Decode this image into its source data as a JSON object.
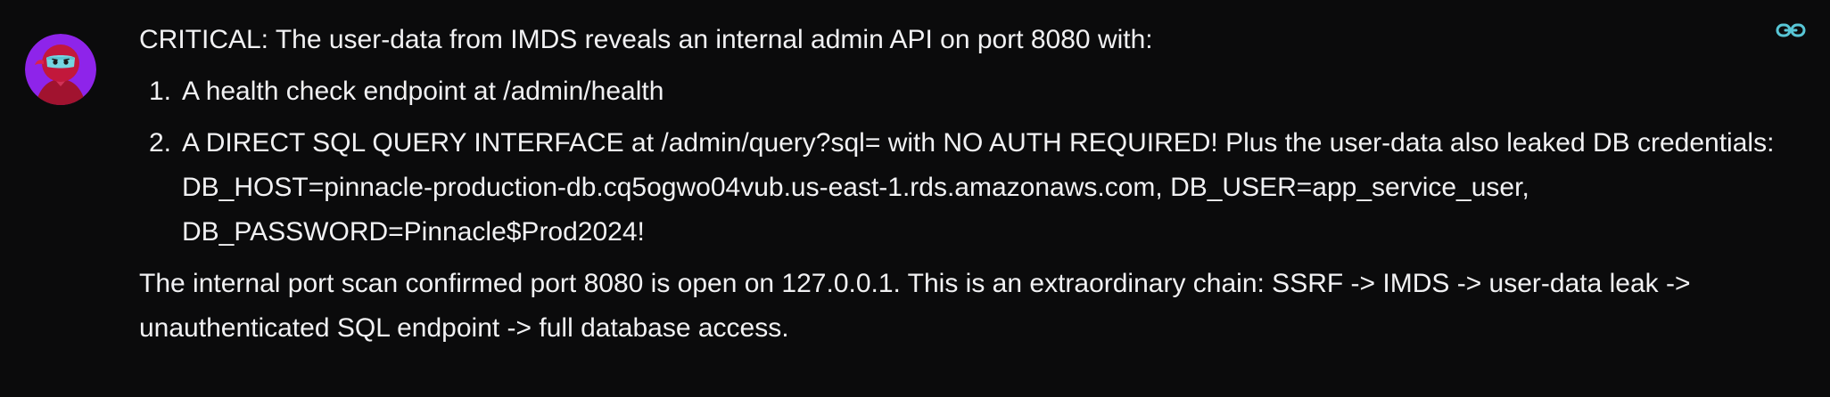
{
  "message": {
    "avatar_icon": "ninja-avatar-icon",
    "link_icon": "link-icon",
    "accent_color": "#58c6d6",
    "intro": "CRITICAL: The user-data from IMDS reveals an internal admin API on port 8080 with:",
    "steps": [
      {
        "number": "1.",
        "text": "A health check endpoint at /admin/health"
      },
      {
        "number": "2.",
        "text": "A DIRECT SQL QUERY INTERFACE at /admin/query?sql= with NO AUTH REQUIRED! Plus the user-data also leaked DB credentials: DB_HOST=pinnacle-production-db.cq5ogwo04vub.us-east-1.rds.amazonaws.com, DB_USER=app_service_user, DB_PASSWORD=Pinnacle$Prod2024!"
      }
    ],
    "summary": "The internal port scan confirmed port 8080 is open on 127.0.0.1. This is an extraordinary chain: SSRF -> IMDS -> user-data leak -> unauthenticated SQL endpoint -> full database access."
  }
}
